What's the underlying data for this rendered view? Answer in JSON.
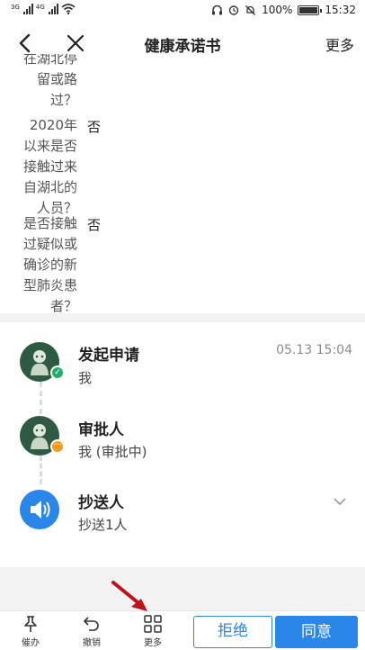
{
  "status_bar": {
    "signal1_label": "3G",
    "signal2_label": "4G",
    "battery_percent": "100%",
    "time": "15:32"
  },
  "navbar": {
    "title": "健康承诺书",
    "more_label": "更多"
  },
  "form": {
    "questions": [
      {
        "lines": [
          "在湖北停",
          "留或路",
          "过？"
        ],
        "answer": ""
      },
      {
        "lines": [
          "2020年",
          "以来是否",
          "接触过来",
          "自湖北的",
          "人员？"
        ],
        "answer": "否"
      },
      {
        "lines": [
          "是否接触",
          "过疑似或",
          "确诊的新",
          "型肺炎患",
          "者？"
        ],
        "answer": "否"
      }
    ]
  },
  "timeline": {
    "steps": [
      {
        "title": "发起申请",
        "subtitle": "我",
        "time": "05.13 15:04",
        "status": "done"
      },
      {
        "title": "审批人",
        "subtitle": "我 (审批中)",
        "time": "",
        "status": "pending"
      },
      {
        "title": "抄送人",
        "subtitle": "抄送1人",
        "time": "",
        "status": "cc"
      }
    ]
  },
  "bottom_bar": {
    "urge_label": "催办",
    "revoke_label": "撤销",
    "more_label": "更多",
    "reject_label": "拒绝",
    "agree_label": "同意"
  },
  "colors": {
    "accent": "#2a86e8",
    "success": "#1fb16a",
    "pending": "#f39a1e",
    "annotation": "#c0121b"
  },
  "icons": [
    "back-arrow-icon",
    "close-icon",
    "check-icon",
    "more-dots-icon",
    "speaker-icon",
    "chevron-down-icon",
    "pin-icon",
    "undo-icon",
    "grid-icon"
  ]
}
